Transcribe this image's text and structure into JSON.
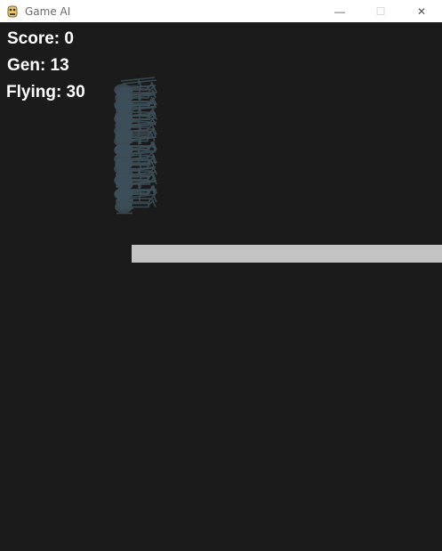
{
  "window": {
    "title": "Game AI",
    "controls": {
      "minimize_glyph": "—",
      "maximize_glyph": "☐",
      "close_glyph": "✕"
    }
  },
  "hud": {
    "score_label": "Score: 0",
    "gen_label": "Gen: 13",
    "flying_label": "Flying: 30"
  },
  "game": {
    "background_color": "#1b1b1b",
    "obstacle_color": "#c3c3c3",
    "helicopter_color": "#3d4f58",
    "flying_count": 30
  }
}
